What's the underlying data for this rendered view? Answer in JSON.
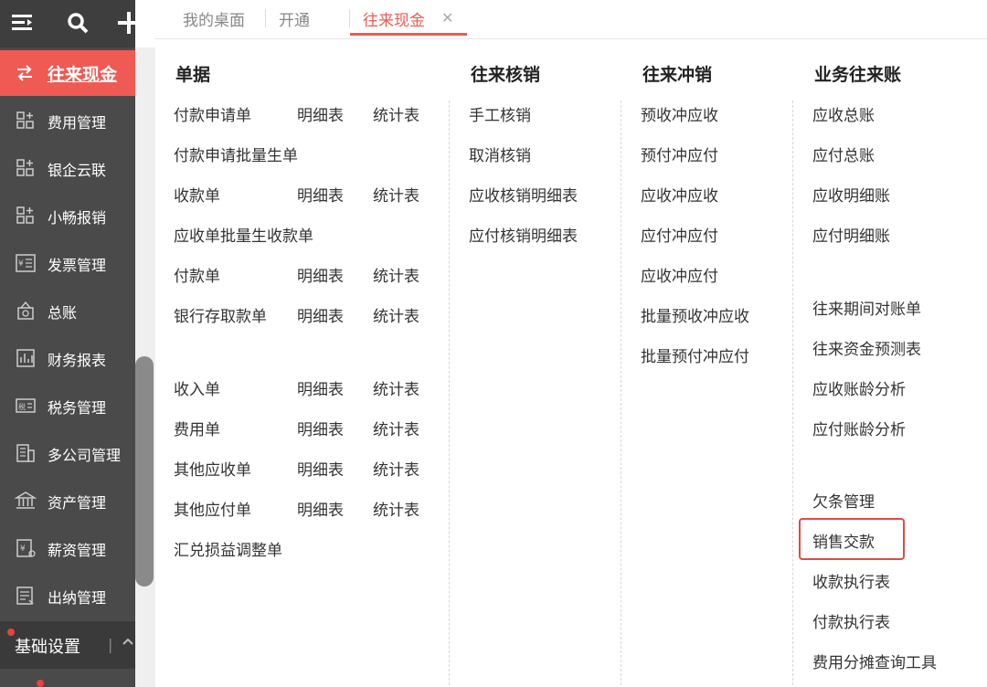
{
  "tabs": [
    {
      "label": "我的桌面"
    },
    {
      "label": "开通"
    },
    {
      "label": "往来现金"
    }
  ],
  "sidebar": {
    "active": {
      "label": "往来现金"
    },
    "items": [
      {
        "label": "费用管理",
        "icon": "grid-plus-icon"
      },
      {
        "label": "银企云联",
        "icon": "grid-plus-icon"
      },
      {
        "label": "小畅报销",
        "icon": "grid-plus-icon"
      },
      {
        "label": "发票管理",
        "icon": "invoice-icon"
      },
      {
        "label": "总账",
        "icon": "ledger-icon"
      },
      {
        "label": "财务报表",
        "icon": "report-icon"
      },
      {
        "label": "税务管理",
        "icon": "tax-icon"
      },
      {
        "label": "多公司管理",
        "icon": "building-icon"
      },
      {
        "label": "资产管理",
        "icon": "bank-icon"
      },
      {
        "label": "薪资管理",
        "icon": "salary-icon"
      },
      {
        "label": "出纳管理",
        "icon": "cashier-icon"
      }
    ],
    "bottom": {
      "label": "基础设置"
    }
  },
  "menu": {
    "col1": {
      "header": "单据",
      "rows": [
        {
          "main": "付款申请单",
          "detail": "明细表",
          "stat": "统计表"
        },
        {
          "main": "付款申请批量生单"
        },
        {
          "main": "收款单",
          "detail": "明细表",
          "stat": "统计表"
        },
        {
          "main": "应收单批量生收款单"
        },
        {
          "main": "付款单",
          "detail": "明细表",
          "stat": "统计表"
        },
        {
          "main": "银行存取款单",
          "detail": "明细表",
          "stat": "统计表"
        },
        {
          "main": "收入单",
          "detail": "明细表",
          "stat": "统计表"
        },
        {
          "main": "费用单",
          "detail": "明细表",
          "stat": "统计表"
        },
        {
          "main": "其他应收单",
          "detail": "明细表",
          "stat": "统计表"
        },
        {
          "main": "其他应付单",
          "detail": "明细表",
          "stat": "统计表"
        },
        {
          "main": "汇兑损益调整单"
        }
      ]
    },
    "col2": {
      "header": "往来核销",
      "items": [
        "手工核销",
        "取消核销",
        "应收核销明细表",
        "应付核销明细表"
      ]
    },
    "col3": {
      "header": "往来冲销",
      "items": [
        "预收冲应收",
        "预付冲应付",
        "应收冲应收",
        "应付冲应付",
        "应收冲应付",
        "批量预收冲应收",
        "批量预付冲应付"
      ]
    },
    "col4": {
      "header": "业务往来账",
      "items": [
        "应收总账",
        "应付总账",
        "应收明细账",
        "应付明细账",
        "往来期间对账单",
        "往来资金预测表",
        "应收账龄分析",
        "应付账龄分析",
        "欠条管理",
        "销售交款",
        "收款执行表",
        "付款执行表",
        "费用分摊查询工具"
      ]
    }
  },
  "colors": {
    "accent": "#ef5a54",
    "sidebar": "#4a4a4a"
  }
}
